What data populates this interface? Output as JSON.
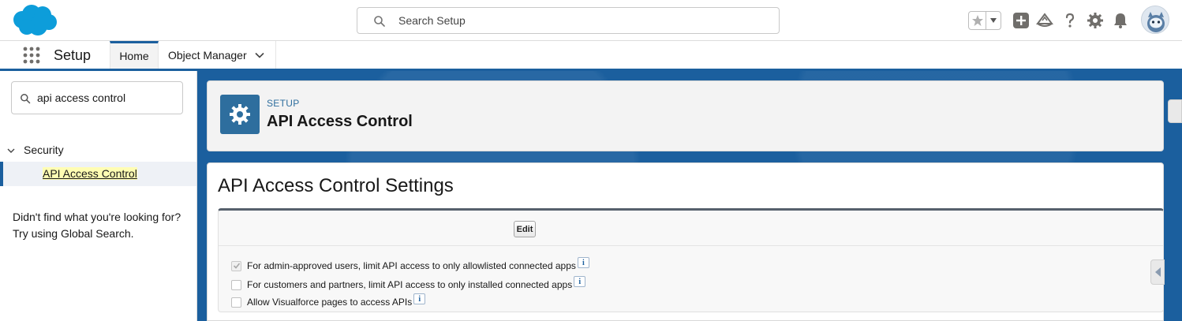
{
  "global_header": {
    "search_placeholder": "Search Setup"
  },
  "context_bar": {
    "app_name": "Setup",
    "tabs": [
      {
        "label": "Home"
      },
      {
        "label": "Object Manager"
      }
    ]
  },
  "sidebar": {
    "quick_find_value": "api access control",
    "section_label": "Security",
    "active_item_label": "API Access Control",
    "help_text": "Didn't find what you're looking for? Try using Global Search."
  },
  "page_header": {
    "eyebrow": "SETUP",
    "title": "API Access Control"
  },
  "settings": {
    "title": "API Access Control Settings",
    "edit_label": "Edit",
    "info_glyph": "i",
    "options": [
      {
        "label": "For admin-approved users, limit API access to only allowlisted connected apps",
        "checked": true
      },
      {
        "label": "For customers and partners, limit API access to only installed connected apps",
        "checked": false
      },
      {
        "label": "Allow Visualforce pages to access APIs",
        "checked": false
      }
    ]
  },
  "colors": {
    "brand_blue": "#1b5f9e",
    "cloud_blue": "#0d9dda"
  }
}
